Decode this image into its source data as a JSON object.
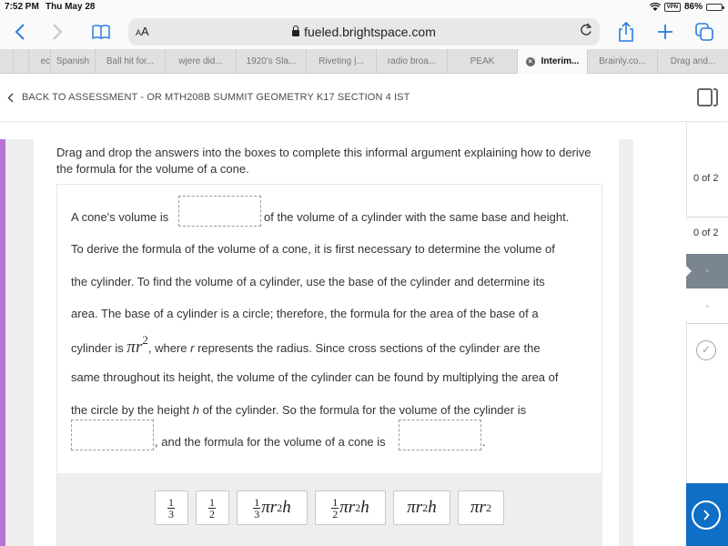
{
  "status_bar": {
    "time": "7:52 PM",
    "date": "Thu May 28",
    "vpn_label": "VPN",
    "battery_percent": "86%",
    "battery_level": 0.86
  },
  "browser": {
    "text_size_label_small": "A",
    "text_size_label_large": "A",
    "url": "fueled.brightspace.com",
    "icons": {
      "back": "chevron-left-icon",
      "forward": "chevron-right-icon",
      "bookmarks": "book-icon",
      "lock": "lock-icon",
      "reload": "reload-icon",
      "share": "share-icon",
      "new_tab": "plus-icon",
      "tabs": "tabs-icon"
    },
    "tabs": [
      {
        "label": ""
      },
      {
        "label": ""
      },
      {
        "label": "ec"
      },
      {
        "label": "Spanish"
      },
      {
        "label": "Ball hit for..."
      },
      {
        "label": "wjere did..."
      },
      {
        "label": "1920's Sla..."
      },
      {
        "label": "Riveting |..."
      },
      {
        "label": "radio broa..."
      },
      {
        "label": "PEAK"
      },
      {
        "label": "Interim...",
        "active": true
      },
      {
        "label": "Brainly.co..."
      },
      {
        "label": "Drag and..."
      }
    ]
  },
  "header": {
    "back_link": "BACK TO ASSESSMENT - OR MTH208B SUMMIT GEOMETRY K17 SECTION 4 IST"
  },
  "question": {
    "instructions": "Drag and drop the answers into the boxes to complete this informal argument explaining how to derive the formula for the volume of a cone.",
    "lines": {
      "l1a": "A cone's volume is",
      "l1b": "of the volume of a cylinder with the same base and height.",
      "l2": "To derive the formula of the volume of a cone, it is first necessary to determine the volume of",
      "l3": "the cylinder. To find the volume of a cylinder, use the base of the cylinder and determine its",
      "l4": "area. The base of a cylinder is a circle; therefore, the formula for the area of the base of a",
      "l5a": "cylinder is",
      "l5_math_pi": "π",
      "l5_math_r": "r",
      "l5_math_exp": "2",
      "l5b": ", where",
      "l5_var": "r",
      "l5c": "represents the radius. Since cross sections of the cylinder are the",
      "l6": "same throughout its height, the volume of the cylinder can be found by multiplying the area of",
      "l7a": "the circle by the height",
      "l7_var": "h",
      "l7b": "of the cylinder. So the formula for the volume of the cylinder is",
      "l8a": ",",
      "l8b": "and the formula for the volume of a cone is",
      "l8c": "."
    },
    "drop_zones": [
      {
        "id": "zone-1",
        "value": ""
      },
      {
        "id": "zone-2",
        "value": ""
      },
      {
        "id": "zone-3",
        "value": ""
      }
    ],
    "answer_tiles": [
      {
        "label": "1/3",
        "num": "1",
        "den": "3",
        "expr": ""
      },
      {
        "label": "1/2",
        "num": "1",
        "den": "2",
        "expr": ""
      },
      {
        "label": "1/3 πr²h",
        "num": "1",
        "den": "3",
        "expr": "πr",
        "exp": "2",
        "tail": "h"
      },
      {
        "label": "1/2 πr²h",
        "num": "1",
        "den": "2",
        "expr": "πr",
        "exp": "2",
        "tail": "h"
      },
      {
        "label": "πr²h",
        "expr": "πr",
        "exp": "2",
        "tail": "h"
      },
      {
        "label": "πr²",
        "expr": "πr",
        "exp": "2",
        "tail": ""
      }
    ]
  },
  "nav_panel": {
    "section_count": "0 of 2",
    "group_count": "0 of 2",
    "next_icon": "chevron-right-circle-icon",
    "complete_icon": "check-circle-icon"
  },
  "colors": {
    "accent_purple": "#b774d4",
    "next_blue": "#0f6fc6",
    "nav_current": "#7b8591",
    "ios_blue": "#2a7de1"
  }
}
